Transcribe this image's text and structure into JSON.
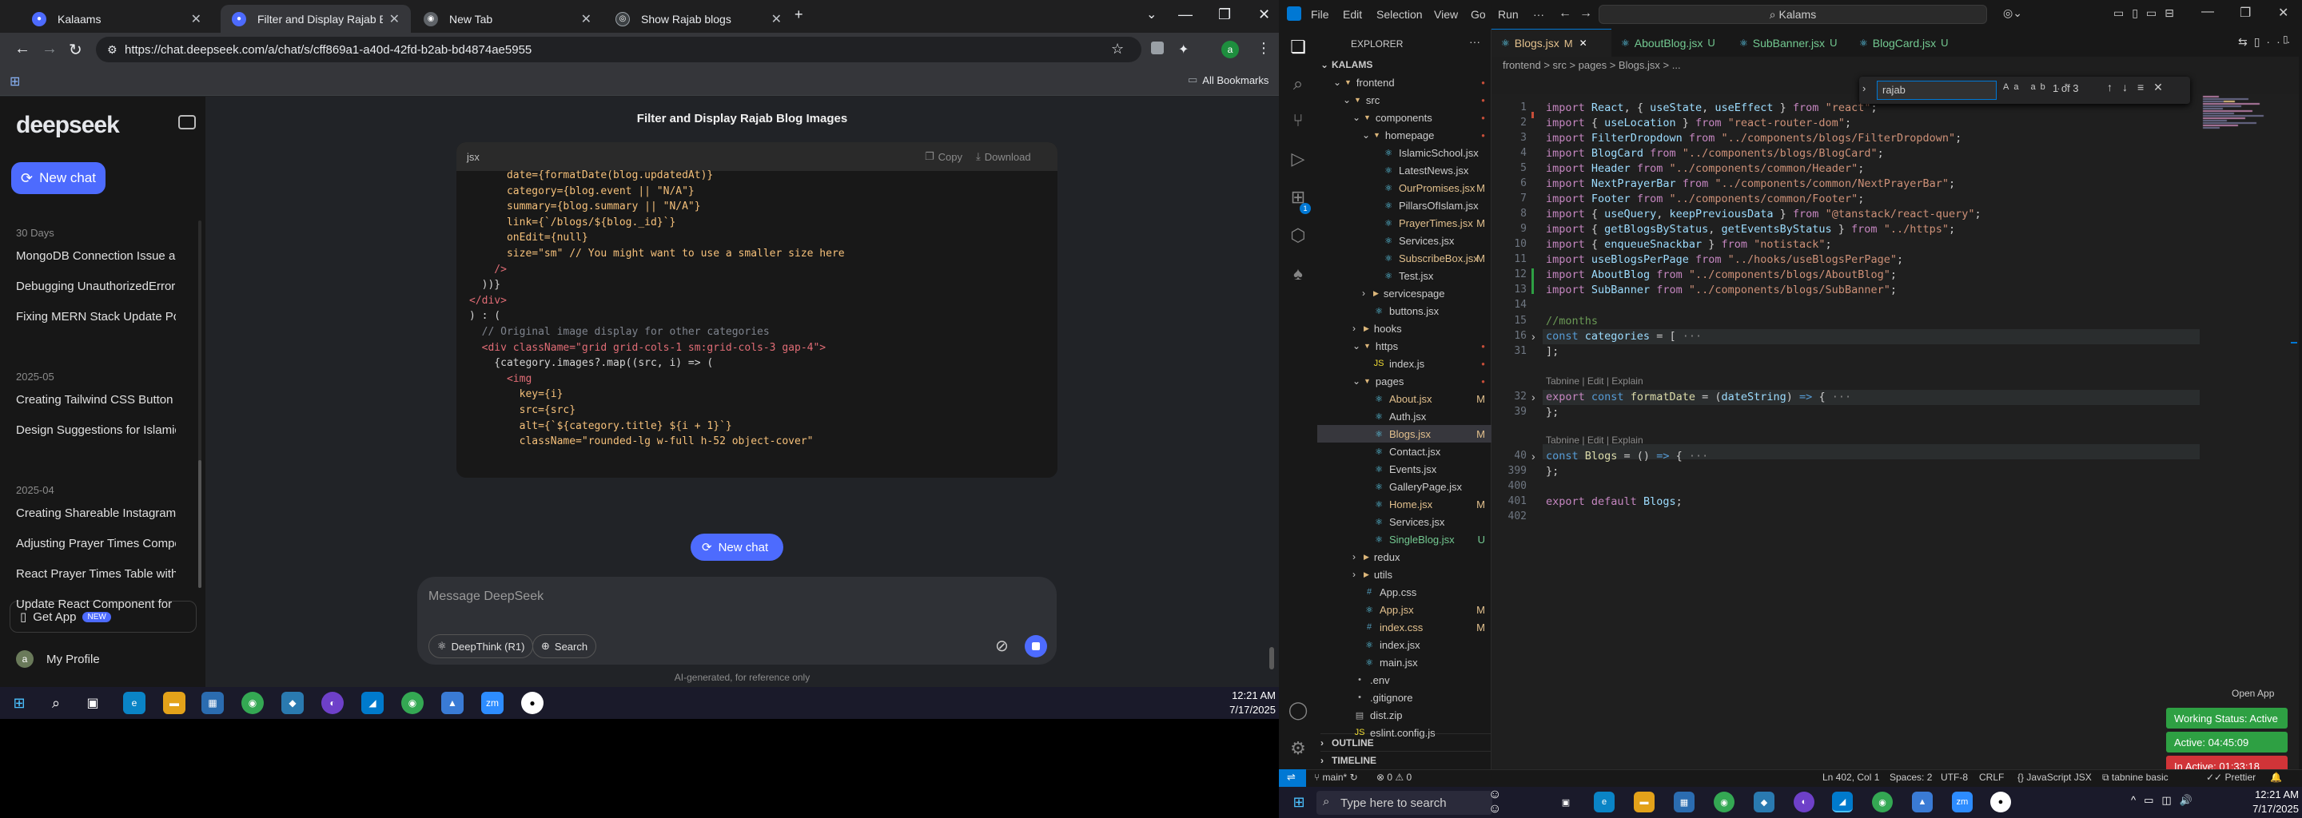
{
  "browser": {
    "tabs": [
      {
        "title": "Kalaams",
        "fav_color": "#4d6bfe"
      },
      {
        "title": "Filter and Display Rajab Blog Im",
        "fav_color": "#4d6bfe"
      },
      {
        "title": "New Tab",
        "fav_color": "#5f6368"
      },
      {
        "title": "Show Rajab blogs",
        "fav_color": "#ffffff"
      }
    ],
    "url": "https://chat.deepseek.com/a/chat/s/cff869a1-a40d-42fd-b2ab-bd4874ae5955",
    "bookmarks_label": "All Bookmarks"
  },
  "deepseek": {
    "logo": "deepseek",
    "new_chat": "New chat",
    "groups": [
      {
        "label": "30 Days",
        "items": [
          "MongoDB Connection Issue and",
          "Debugging UnauthorizedError: Ir",
          "Fixing MERN Stack Update Post I"
        ]
      },
      {
        "label": "2025-05",
        "items": [
          "Creating Tailwind CSS Button Cla",
          "Design Suggestions for Islamic W"
        ]
      },
      {
        "label": "2025-04",
        "items": [
          "Creating Shareable Instagram St",
          "Adjusting Prayer Times Compon",
          "React Prayer Times Table with Ta",
          "Update React Component for Pr"
        ]
      }
    ],
    "get_app": "Get App",
    "new_badge": "NEW",
    "profile": "My Profile",
    "avatar_letter": "a",
    "chat_title": "Filter and Display Rajab Blog Images",
    "code_lang": "jsx",
    "copy": "Copy",
    "download": "Download",
    "code_lines": [
      "      date={formatDate(blog.updatedAt)}",
      "      category={blog.event || \"N/A\"}",
      "      summary={blog.summary || \"N/A\"}",
      "      link={`/blogs/${blog._id}`}",
      "      onEdit={null}",
      "      size=\"sm\" // You might want to use a smaller size here",
      "    />",
      "  ))}",
      "</div>",
      ") : (",
      "  // Original image display for other categories",
      "  <div className=\"grid grid-cols-1 sm:grid-cols-3 gap-4\">",
      "    {category.images?.map((src, i) => (",
      "      <img",
      "        key={i}",
      "        src={src}",
      "        alt={`${category.title} ${i + 1}`}",
      "        className=\"rounded-lg w-full h-52 object-cover\""
    ],
    "new_chat_2": "New chat",
    "input_placeholder": "Message DeepSeek",
    "deepthink": "DeepThink (R1)",
    "search": "Search",
    "footer": "AI-generated, for reference only"
  },
  "taskbar_left": {
    "time": "12:21 AM",
    "date": "7/17/2025"
  },
  "vscode": {
    "menu": [
      "File",
      "Edit",
      "Selection",
      "View",
      "Go",
      "Run",
      "···"
    ],
    "command_center": "Kalams",
    "explorer_title": "EXPLORER",
    "root": "KALAMS",
    "tree": [
      {
        "label": "frontend",
        "depth": 1,
        "type": "folder",
        "open": true,
        "mark": "dot"
      },
      {
        "label": "src",
        "depth": 2,
        "type": "folder",
        "open": true,
        "mark": "dot"
      },
      {
        "label": "components",
        "depth": 3,
        "type": "folder",
        "open": true,
        "mark": "dot"
      },
      {
        "label": "homepage",
        "depth": 4,
        "type": "folder",
        "open": true,
        "mark": "dot"
      },
      {
        "label": "IslamicSchool.jsx",
        "depth": 5,
        "type": "file",
        "mark": ""
      },
      {
        "label": "LatestNews.jsx",
        "depth": 5,
        "type": "file",
        "mark": ""
      },
      {
        "label": "OurPromises.jsx",
        "depth": 5,
        "type": "file",
        "mark": "M"
      },
      {
        "label": "PillarsOfIslam.jsx",
        "depth": 5,
        "type": "file",
        "mark": ""
      },
      {
        "label": "PrayerTimes.jsx",
        "depth": 5,
        "type": "file",
        "mark": "M"
      },
      {
        "label": "Services.jsx",
        "depth": 5,
        "type": "file",
        "mark": ""
      },
      {
        "label": "SubscribeBox.jsx",
        "depth": 5,
        "type": "file",
        "mark": "M"
      },
      {
        "label": "Test.jsx",
        "depth": 5,
        "type": "file",
        "mark": ""
      },
      {
        "label": "servicespage",
        "depth": 4,
        "type": "folder",
        "open": false,
        "mark": ""
      },
      {
        "label": "buttons.jsx",
        "depth": 4,
        "type": "file",
        "mark": ""
      },
      {
        "label": "hooks",
        "depth": 3,
        "type": "folder",
        "open": false,
        "mark": ""
      },
      {
        "label": "https",
        "depth": 3,
        "type": "folder",
        "open": true,
        "mark": "dot"
      },
      {
        "label": "index.js",
        "depth": 4,
        "type": "file",
        "mark": "dot"
      },
      {
        "label": "pages",
        "depth": 3,
        "type": "folder",
        "open": true,
        "mark": "dot"
      },
      {
        "label": "About.jsx",
        "depth": 4,
        "type": "file",
        "mark": "M"
      },
      {
        "label": "Auth.jsx",
        "depth": 4,
        "type": "file",
        "mark": ""
      },
      {
        "label": "Blogs.jsx",
        "depth": 4,
        "type": "file",
        "mark": "M",
        "selected": true
      },
      {
        "label": "Contact.jsx",
        "depth": 4,
        "type": "file",
        "mark": ""
      },
      {
        "label": "Events.jsx",
        "depth": 4,
        "type": "file",
        "mark": ""
      },
      {
        "label": "GalleryPage.jsx",
        "depth": 4,
        "type": "file",
        "mark": ""
      },
      {
        "label": "Home.jsx",
        "depth": 4,
        "type": "file",
        "mark": "M"
      },
      {
        "label": "Services.jsx",
        "depth": 4,
        "type": "file",
        "mark": ""
      },
      {
        "label": "SingleBlog.jsx",
        "depth": 4,
        "type": "file",
        "mark": "U"
      },
      {
        "label": "redux",
        "depth": 3,
        "type": "folder",
        "open": false,
        "mark": ""
      },
      {
        "label": "utils",
        "depth": 3,
        "type": "folder",
        "open": false,
        "mark": ""
      },
      {
        "label": "App.css",
        "depth": 3,
        "type": "file",
        "mark": ""
      },
      {
        "label": "App.jsx",
        "depth": 3,
        "type": "file",
        "mark": "M"
      },
      {
        "label": "index.css",
        "depth": 3,
        "type": "file",
        "mark": "M"
      },
      {
        "label": "index.jsx",
        "depth": 3,
        "type": "file",
        "mark": ""
      },
      {
        "label": "main.jsx",
        "depth": 3,
        "type": "file",
        "mark": ""
      },
      {
        "label": ".env",
        "depth": 2,
        "type": "file",
        "mark": ""
      },
      {
        "label": ".gitignore",
        "depth": 2,
        "type": "file",
        "mark": ""
      },
      {
        "label": "dist.zip",
        "depth": 2,
        "type": "file",
        "mark": ""
      },
      {
        "label": "eslint.config.js",
        "depth": 2,
        "type": "file",
        "mark": ""
      }
    ],
    "outline": "OUTLINE",
    "timeline": "TIMELINE",
    "tabs": [
      {
        "label": "Blogs.jsx",
        "mark": "M",
        "active": true
      },
      {
        "label": "AboutBlog.jsx",
        "mark": "U",
        "active": false
      },
      {
        "label": "SubBanner.jsx",
        "mark": "U",
        "active": false
      },
      {
        "label": "BlogCard.jsx",
        "mark": "U",
        "active": false
      }
    ],
    "breadcrumb": "frontend > src > pages > Blogs.jsx > ...",
    "find_query": "rajab",
    "find_count": "1 of 3",
    "line_numbers": [
      "1",
      "2",
      "3",
      "4",
      "5",
      "6",
      "7",
      "8",
      "9",
      "10",
      "11",
      "12",
      "13",
      "14",
      "15",
      "16",
      "31",
      "",
      "32",
      "39",
      "",
      "40",
      "399",
      "400",
      "401",
      "402"
    ],
    "codelens": "Tabnine | Edit | Explain",
    "status": {
      "branch": "main*",
      "problems": "0 ⚠ 0",
      "position": "Ln 402, Col 1",
      "spaces": "Spaces: 2",
      "encoding": "UTF-8",
      "eol": "CRLF",
      "lang": "{} JavaScript JSX",
      "tabnine": "tabnine basic",
      "prettier": "Prettier"
    },
    "open_app": "Open App",
    "popups": [
      "Working Status: Active",
      "Active: 04:45:09",
      "In Active: 01:33:18"
    ]
  },
  "taskbar_right": {
    "search_placeholder": "Type here to search",
    "time": "12:21 AM",
    "date": "7/17/2025"
  },
  "colors": {
    "accent": "#4d6bfe",
    "vscode_blue": "#0078d4",
    "popup_green": "#2ea043",
    "popup_red": "#d13438"
  }
}
